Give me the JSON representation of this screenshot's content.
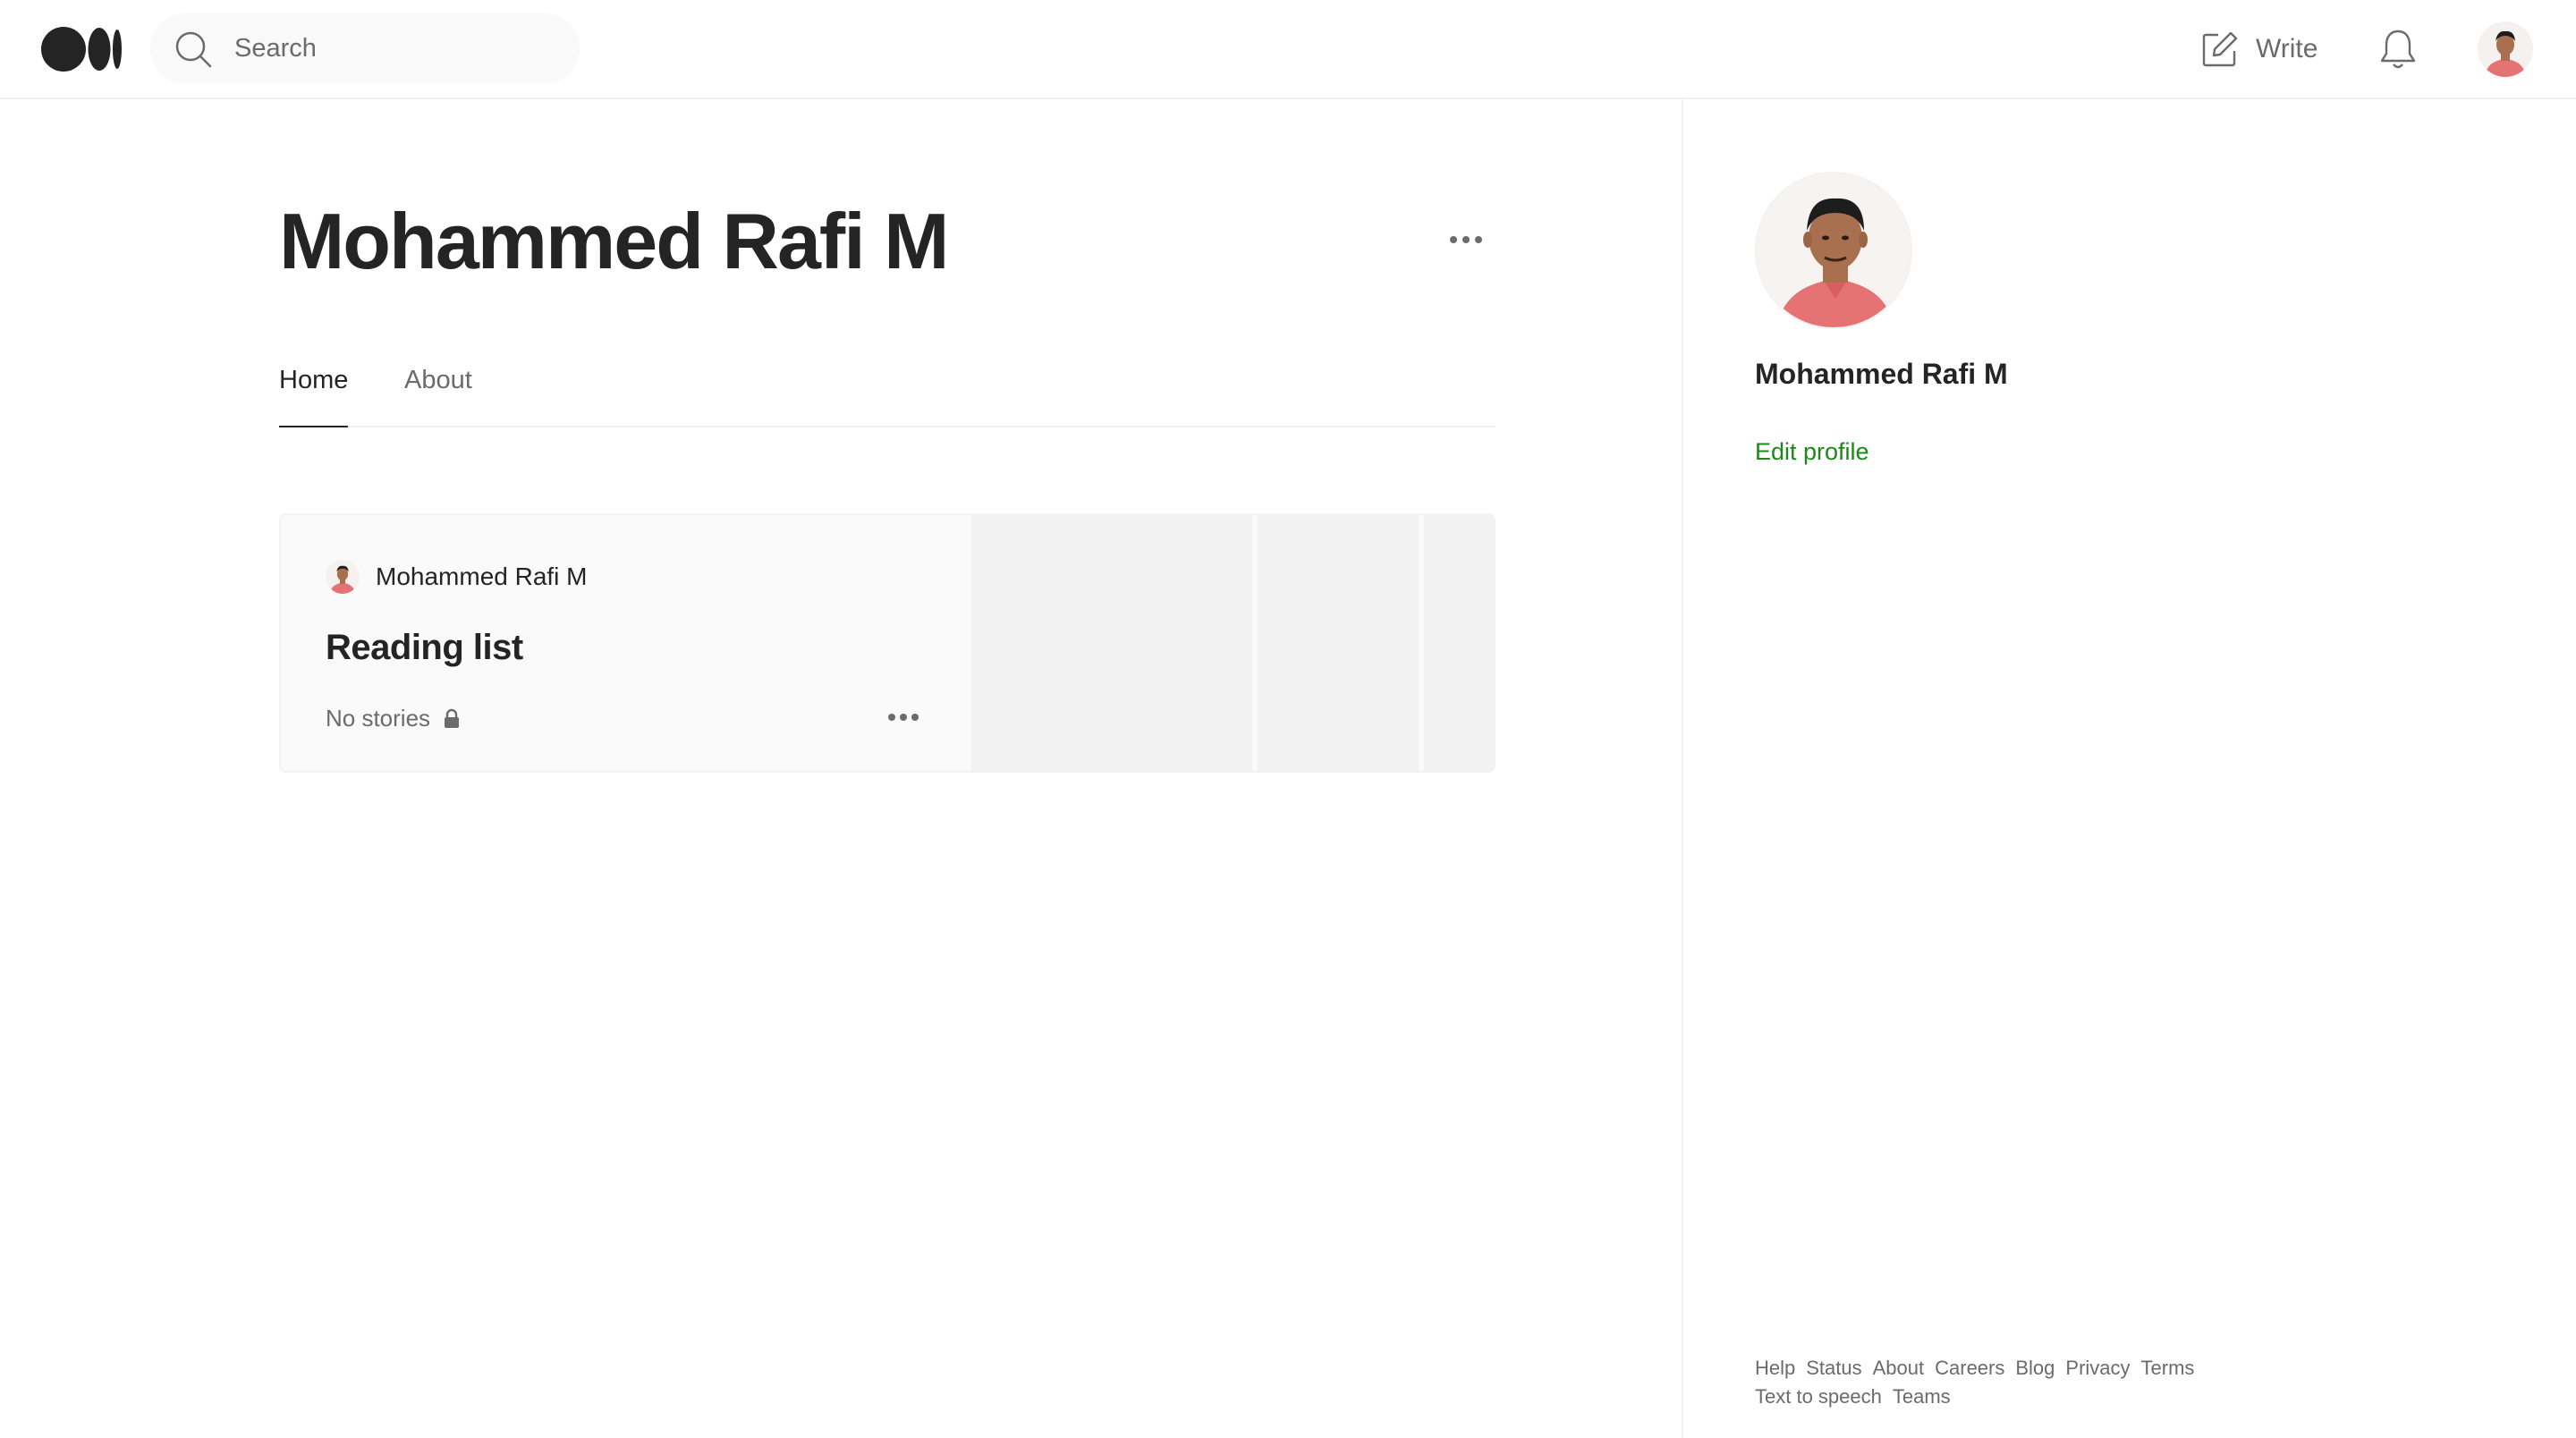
{
  "nav": {
    "logo_icon": "medium-logo-icon",
    "search": {
      "placeholder": "Search",
      "icon": "search-icon"
    },
    "write_label": "Write",
    "write_icon": "pencil-square-icon",
    "bell_icon": "bell-icon",
    "avatar_icon": "user-avatar"
  },
  "profile": {
    "name": "Mohammed Rafi M",
    "more_icon": "ellipsis-icon",
    "tabs": [
      {
        "label": "Home",
        "active": true
      },
      {
        "label": "About",
        "active": false
      }
    ]
  },
  "reading_list": {
    "author": "Mohammed Rafi M",
    "title": "Reading list",
    "stories": "No stories",
    "lock_icon": "lock-icon",
    "more_icon": "ellipsis-icon"
  },
  "sidebar": {
    "name": "Mohammed Rafi M",
    "edit_label": "Edit profile",
    "footer_links": [
      "Help",
      "Status",
      "About",
      "Careers",
      "Blog",
      "Privacy",
      "Terms",
      "Text to speech",
      "Teams"
    ]
  },
  "colors": {
    "accent_green": "#1a8917",
    "text_primary": "#242424",
    "text_secondary": "#6b6b6b",
    "border": "#f2f2f2",
    "avatar_shirt": "#e57373"
  }
}
